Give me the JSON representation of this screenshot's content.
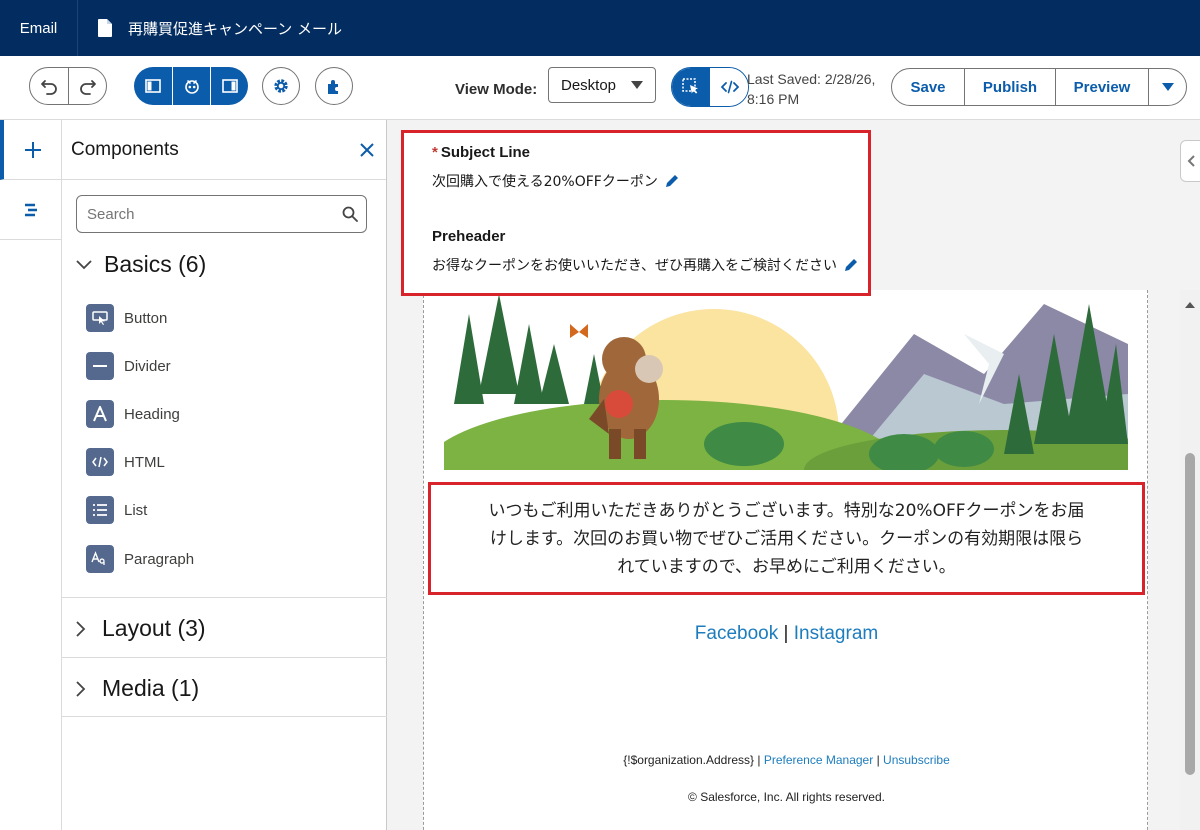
{
  "topbar": {
    "app_label": "Email",
    "doc_title": "再購買促進キャンペーン メール"
  },
  "toolbar": {
    "view_mode_label": "View Mode:",
    "view_mode_value": "Desktop",
    "last_saved_line1": "Last Saved: 2/28/26,",
    "last_saved_line2": "8:16 PM",
    "save_label": "Save",
    "publish_label": "Publish",
    "preview_label": "Preview"
  },
  "panel": {
    "title": "Components",
    "search_placeholder": "Search",
    "sections": [
      {
        "label": "Basics (6)"
      },
      {
        "label": "Layout (3)"
      },
      {
        "label": "Media (1)"
      }
    ],
    "components": [
      {
        "label": "Button",
        "icon": "button-icon"
      },
      {
        "label": "Divider",
        "icon": "divider-icon"
      },
      {
        "label": "Heading",
        "icon": "heading-icon"
      },
      {
        "label": "HTML",
        "icon": "code-icon"
      },
      {
        "label": "List",
        "icon": "list-icon"
      },
      {
        "label": "Paragraph",
        "icon": "paragraph-icon"
      }
    ]
  },
  "email": {
    "subject_label": "Subject Line",
    "subject_value": "次回購入で使える20%OFFクーポン",
    "preheader_label": "Preheader",
    "preheader_value": "お得なクーポンをお使いいただき、ぜひ再購入をご検討ください",
    "message_lines": [
      "いつもご利用いただきありがとうございます。特別な20%OFFクーポンをお届",
      "けします。次回のお買い物でぜひご活用ください。クーポンの有効期限は限ら",
      "れていますので、お早めにご利用ください。"
    ],
    "social": {
      "facebook": "Facebook",
      "separator": "|",
      "instagram": "Instagram"
    },
    "footer": {
      "address": "{!$organization.Address}",
      "sep": "|",
      "preference": "Preference Manager",
      "unsubscribe": "Unsubscribe",
      "copyright": "© Salesforce, Inc. All rights reserved."
    }
  },
  "colors": {
    "topbar": "#032d60",
    "brand_blue": "#0b5cab",
    "highlight_red": "#d8232a",
    "link": "#1d7dbd"
  }
}
